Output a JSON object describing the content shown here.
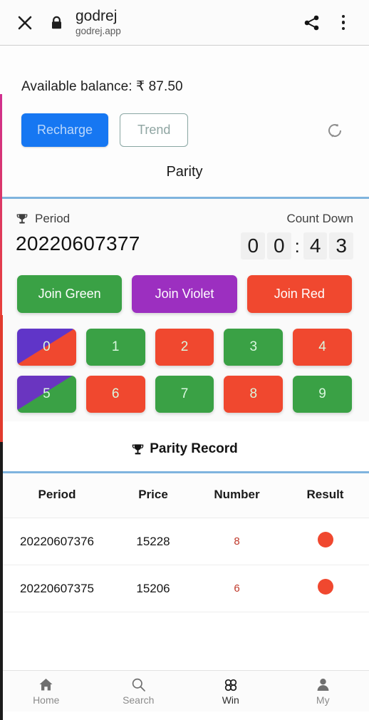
{
  "browser_bar": {
    "close_icon": "close-icon",
    "lock_icon": "lock-icon",
    "title": "godrej",
    "url": "godrej.app",
    "share_icon": "share-icon",
    "menu_icon": "overflow-menu-icon"
  },
  "balance": {
    "label": "Available balance: ₹ 87.50",
    "recharge_label": "Recharge",
    "trend_label": "Trend",
    "refresh_icon": "refresh-icon",
    "accent_blue": "#1677f2"
  },
  "tab": {
    "label": "Parity"
  },
  "game": {
    "period_icon": "trophy-icon",
    "period_label": "Period",
    "period_value": "20220607377",
    "countdown_label": "Count Down",
    "countdown": [
      "0",
      "0",
      "4",
      "3"
    ],
    "countdown_separator": ":",
    "joins": [
      {
        "label": "Join Green",
        "style": "green",
        "color": "#3aa145"
      },
      {
        "label": "Join Violet",
        "style": "violet",
        "color": "#9c2fc0"
      },
      {
        "label": "Join Red",
        "style": "red",
        "color": "#f0482f"
      }
    ],
    "numbers": [
      {
        "n": "0",
        "style": "violet-red"
      },
      {
        "n": "1",
        "style": "green"
      },
      {
        "n": "2",
        "style": "red"
      },
      {
        "n": "3",
        "style": "green"
      },
      {
        "n": "4",
        "style": "red"
      },
      {
        "n": "5",
        "style": "violet-green"
      },
      {
        "n": "6",
        "style": "red"
      },
      {
        "n": "7",
        "style": "green"
      },
      {
        "n": "8",
        "style": "red"
      },
      {
        "n": "9",
        "style": "green"
      }
    ]
  },
  "record": {
    "icon": "trophy-icon",
    "title": "Parity Record",
    "columns": [
      "Period",
      "Price",
      "Number",
      "Result"
    ],
    "rows": [
      {
        "period": "20220607376",
        "price": "15228",
        "number": "8",
        "result": "red"
      },
      {
        "period": "20220607375",
        "price": "15206",
        "number": "6",
        "result": "red"
      }
    ]
  },
  "bottom_nav": {
    "items": [
      {
        "label": "Home",
        "icon": "home-icon",
        "active": false
      },
      {
        "label": "Search",
        "icon": "search-icon",
        "active": false
      },
      {
        "label": "Win",
        "icon": "win-icon",
        "active": true
      },
      {
        "label": "My",
        "icon": "person-icon",
        "active": false
      }
    ]
  }
}
